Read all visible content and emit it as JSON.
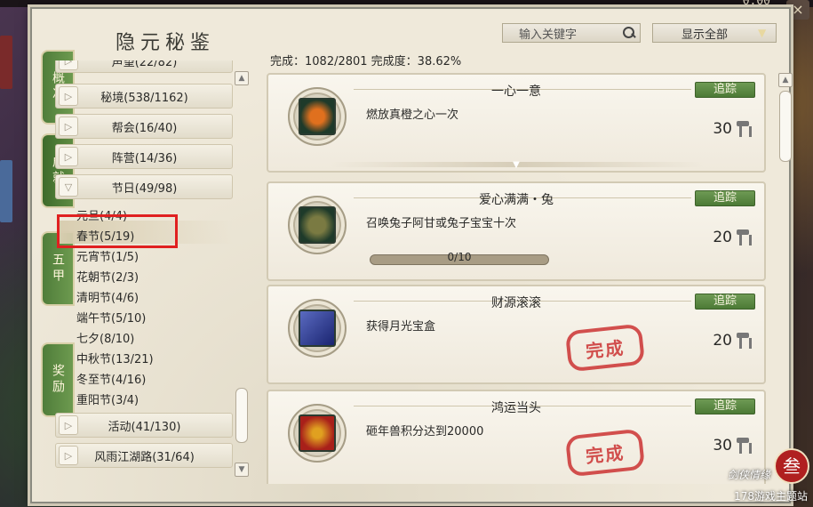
{
  "clock": "0:00",
  "window": {
    "title": "隐元秘鉴",
    "tabs": [
      {
        "label": "概况",
        "active": false
      },
      {
        "label": "成就",
        "active": true
      },
      {
        "label": "五甲",
        "active": false
      },
      {
        "label": "奖励",
        "active": false
      }
    ]
  },
  "categories": {
    "top": [
      {
        "label": "声望(22/82)"
      },
      {
        "label": "秘境(538/1162)"
      },
      {
        "label": "帮会(16/40)"
      },
      {
        "label": "阵营(14/36)"
      }
    ],
    "expanded": {
      "label": "节日(49/98)"
    },
    "sub_items": [
      {
        "label": "元旦(4/4)"
      },
      {
        "label": "春节(5/19)",
        "selected": true
      },
      {
        "label": "元宵节(1/5)"
      },
      {
        "label": "花朝节(2/3)"
      },
      {
        "label": "清明节(4/6)"
      },
      {
        "label": "端午节(5/10)"
      },
      {
        "label": "七夕(8/10)"
      },
      {
        "label": "中秋节(13/21)"
      },
      {
        "label": "冬至节(4/16)"
      },
      {
        "label": "重阳节(3/4)"
      }
    ],
    "bottom": [
      {
        "label": "活动(41/130)"
      },
      {
        "label": "风雨江湖路(31/64)"
      }
    ]
  },
  "search": {
    "placeholder": "输入关键字"
  },
  "filter": {
    "value": "显示全部"
  },
  "summary": "完成：1082/2801 完成度：38.62%",
  "achievements": [
    {
      "title": "一心一意",
      "desc": "燃放真橙之心一次",
      "track": "追踪",
      "points": "30",
      "completed": false,
      "progress": null,
      "icon_color": "#c04a14",
      "icon_name": "orange-heart-icon"
    },
    {
      "title": "爱心满满・兔",
      "desc": "召唤兔子阿甘或兔子宝宝十次",
      "track": "追踪",
      "points": "20",
      "completed": false,
      "progress": "0/10",
      "icon_color": "#6b6a3a",
      "icon_name": "rabbit-jar-icon"
    },
    {
      "title": "财源滚滚",
      "desc": "获得月光宝盒",
      "track": "追踪",
      "points": "20",
      "completed": true,
      "progress": null,
      "icon_color": "#2a3a8a",
      "icon_name": "moonlight-box-icon"
    },
    {
      "title": "鸿运当头",
      "desc": "砸年兽积分达到20000",
      "track": "追踪",
      "points": "30",
      "completed": true,
      "progress": null,
      "icon_color": "#b8301a",
      "icon_name": "nian-beast-icon"
    }
  ],
  "stamp_text": "完成",
  "watermark": {
    "logo": "叁",
    "text": "178游戏主题站",
    "brand": "剑侠情缘"
  }
}
